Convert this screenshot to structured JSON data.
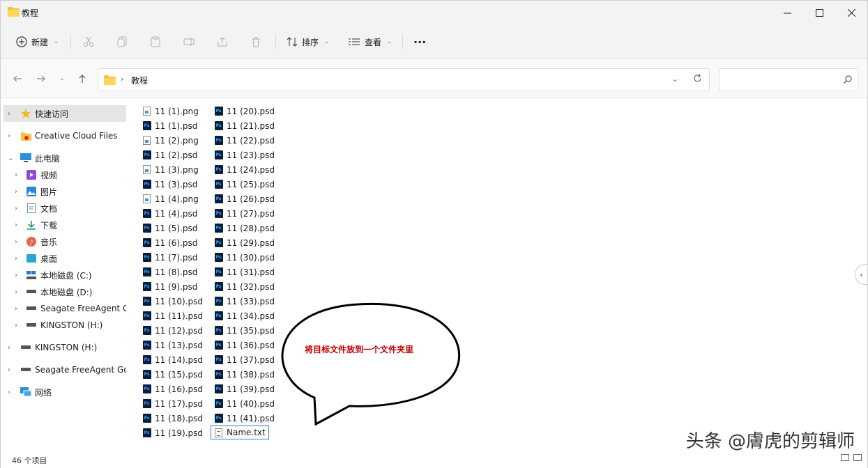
{
  "window": {
    "title": "教程",
    "accent": "#2a7ad6"
  },
  "toolbar": {
    "new_label": "新建",
    "sort_label": "排序",
    "view_label": "查看",
    "more_label": "···"
  },
  "address": {
    "path": "教程",
    "search_placeholder": ""
  },
  "sidebar": {
    "items": [
      {
        "label": "快速访问",
        "icon": "star-icon"
      },
      {
        "label": "Creative Cloud Files",
        "icon": "creative-cloud-icon"
      },
      {
        "label": "此电脑",
        "icon": "computer-icon"
      },
      {
        "label": "视频",
        "icon": "video-icon"
      },
      {
        "label": "图片",
        "icon": "picture-icon"
      },
      {
        "label": "文档",
        "icon": "document-icon"
      },
      {
        "label": "下载",
        "icon": "download-icon"
      },
      {
        "label": "音乐",
        "icon": "music-icon"
      },
      {
        "label": "桌面",
        "icon": "desktop-icon"
      },
      {
        "label": "本地磁盘 (C:)",
        "icon": "drive-icon"
      },
      {
        "label": "本地磁盘 (D:)",
        "icon": "drive-icon"
      },
      {
        "label": "Seagate FreeAgent G",
        "icon": "drive-icon"
      },
      {
        "label": "KINGSTON (H:)",
        "icon": "drive-icon"
      },
      {
        "label": "KINGSTON (H:)",
        "icon": "drive-icon"
      },
      {
        "label": "Seagate FreeAgent Go",
        "icon": "drive-icon"
      },
      {
        "label": "网络",
        "icon": "network-icon"
      }
    ]
  },
  "files": {
    "column1": [
      {
        "name": "11 (1).png",
        "type": "png"
      },
      {
        "name": "11 (1).psd",
        "type": "psd"
      },
      {
        "name": "11 (2).png",
        "type": "png"
      },
      {
        "name": "11 (2).psd",
        "type": "psd"
      },
      {
        "name": "11 (3).png",
        "type": "png"
      },
      {
        "name": "11 (3).psd",
        "type": "psd"
      },
      {
        "name": "11 (4).png",
        "type": "png"
      },
      {
        "name": "11 (4).psd",
        "type": "psd"
      },
      {
        "name": "11 (5).psd",
        "type": "psd"
      },
      {
        "name": "11 (6).psd",
        "type": "psd"
      },
      {
        "name": "11 (7).psd",
        "type": "psd"
      },
      {
        "name": "11 (8).psd",
        "type": "psd"
      },
      {
        "name": "11 (9).psd",
        "type": "psd"
      },
      {
        "name": "11 (10).psd",
        "type": "psd"
      },
      {
        "name": "11 (11).psd",
        "type": "psd"
      },
      {
        "name": "11 (12).psd",
        "type": "psd"
      },
      {
        "name": "11 (13).psd",
        "type": "psd"
      },
      {
        "name": "11 (14).psd",
        "type": "psd"
      },
      {
        "name": "11 (15).psd",
        "type": "psd"
      },
      {
        "name": "11 (16).psd",
        "type": "psd"
      },
      {
        "name": "11 (17).psd",
        "type": "psd"
      },
      {
        "name": "11 (18).psd",
        "type": "psd"
      },
      {
        "name": "11 (19).psd",
        "type": "psd"
      }
    ],
    "column2": [
      {
        "name": "11 (20).psd",
        "type": "psd"
      },
      {
        "name": "11 (21).psd",
        "type": "psd"
      },
      {
        "name": "11 (22).psd",
        "type": "psd"
      },
      {
        "name": "11 (23).psd",
        "type": "psd"
      },
      {
        "name": "11 (24).psd",
        "type": "psd"
      },
      {
        "name": "11 (25).psd",
        "type": "psd"
      },
      {
        "name": "11 (26).psd",
        "type": "psd"
      },
      {
        "name": "11 (27).psd",
        "type": "psd"
      },
      {
        "name": "11 (28).psd",
        "type": "psd"
      },
      {
        "name": "11 (29).psd",
        "type": "psd"
      },
      {
        "name": "11 (30).psd",
        "type": "psd"
      },
      {
        "name": "11 (31).psd",
        "type": "psd"
      },
      {
        "name": "11 (32).psd",
        "type": "psd"
      },
      {
        "name": "11 (33).psd",
        "type": "psd"
      },
      {
        "name": "11 (34).psd",
        "type": "psd"
      },
      {
        "name": "11 (35).psd",
        "type": "psd"
      },
      {
        "name": "11 (36).psd",
        "type": "psd"
      },
      {
        "name": "11 (37).psd",
        "type": "psd"
      },
      {
        "name": "11 (38).psd",
        "type": "psd"
      },
      {
        "name": "11 (39).psd",
        "type": "psd"
      },
      {
        "name": "11 (40).psd",
        "type": "psd"
      },
      {
        "name": "11 (41).psd",
        "type": "psd"
      },
      {
        "name": "Name.txt",
        "type": "txt"
      }
    ]
  },
  "annotation": {
    "text": "将目标文件放到一个文件夹里",
    "color": "#c00000"
  },
  "status": {
    "item_count": "46 个项目"
  },
  "watermark": "头条 @膚虎的剪辑师"
}
